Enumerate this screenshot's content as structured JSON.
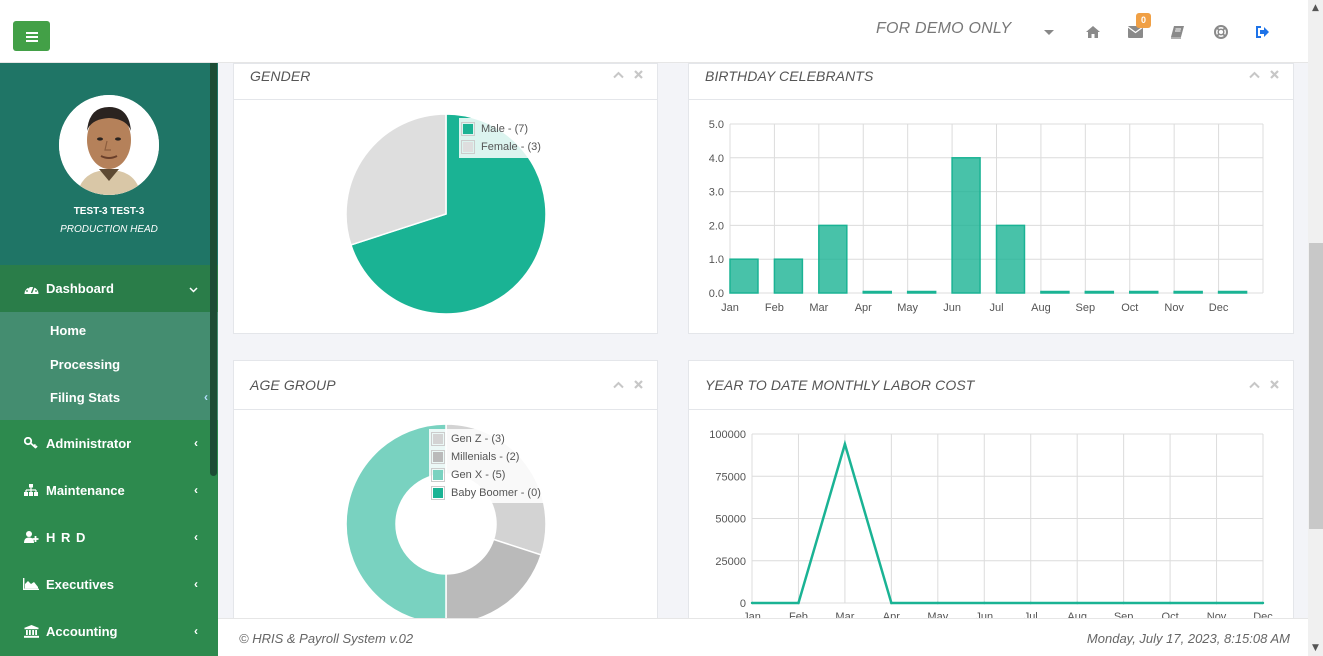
{
  "header": {
    "menu_toggle_icon": "bars-icon",
    "demo_label": "FOR DEMO ONLY",
    "icons": [
      "home-icon",
      "envelope-icon",
      "book-icon",
      "life-ring-icon",
      "sign-out-icon"
    ],
    "mail_badge": "0"
  },
  "profile": {
    "name": "TEST-3 TEST-3",
    "role": "PRODUCTION HEAD"
  },
  "sidebar": {
    "items": [
      {
        "label": "Dashboard",
        "icon": "tachometer-icon",
        "expanded": true
      },
      {
        "label": "Administrator",
        "icon": "key-icon"
      },
      {
        "label": "Maintenance",
        "icon": "sitemap-icon"
      },
      {
        "label": "H R D",
        "icon": "user-plus-icon"
      },
      {
        "label": "Executives",
        "icon": "area-chart-icon"
      },
      {
        "label": "Accounting",
        "icon": "bank-icon"
      }
    ],
    "dashboard_sub": [
      {
        "label": "Home"
      },
      {
        "label": "Processing"
      },
      {
        "label": "Filing Stats"
      }
    ]
  },
  "panels": {
    "gender": {
      "title": "GENDER"
    },
    "birthday": {
      "title": "BIRTHDAY CELEBRANTS"
    },
    "age": {
      "title": "AGE GROUP"
    },
    "labor": {
      "title": "YEAR TO DATE MONTHLY LABOR COST"
    }
  },
  "chart_data": [
    {
      "id": "gender",
      "type": "pie",
      "title": "GENDER",
      "legend_position": "top-right",
      "slices": [
        {
          "label": "Male - (7)",
          "name": "Male",
          "value": 7,
          "color": "#1ab394"
        },
        {
          "label": "Female - (3)",
          "name": "Female",
          "value": 3,
          "color": "#dedede"
        }
      ]
    },
    {
      "id": "birthday",
      "type": "bar",
      "title": "BIRTHDAY CELEBRANTS",
      "categories": [
        "Jan",
        "Feb",
        "Mar",
        "Apr",
        "May",
        "Jun",
        "Jul",
        "Aug",
        "Sep",
        "Oct",
        "Nov",
        "Dec"
      ],
      "values": [
        1,
        1,
        2,
        0,
        0,
        4,
        2,
        0,
        0,
        0,
        0,
        0
      ],
      "yticks": [
        "0.0",
        "1.0",
        "2.0",
        "3.0",
        "4.0",
        "5.0"
      ],
      "ylim": [
        0,
        5
      ],
      "grid": true,
      "color": "#1ab394"
    },
    {
      "id": "age",
      "type": "pie",
      "donut": true,
      "title": "AGE GROUP",
      "legend_position": "top-right",
      "slices": [
        {
          "label": "Gen Z - (3)",
          "name": "Gen Z",
          "value": 3,
          "color": "#d3d3d3"
        },
        {
          "label": "Millenials - (2)",
          "name": "Millenials",
          "value": 2,
          "color": "#bababa"
        },
        {
          "label": "Gen X - (5)",
          "name": "Gen X",
          "value": 5,
          "color": "#79d2c0"
        },
        {
          "label": "Baby Boomer - (0)",
          "name": "Baby Boomer",
          "value": 0,
          "color": "#1ab394"
        }
      ]
    },
    {
      "id": "labor",
      "type": "line",
      "title": "YEAR TO DATE MONTHLY LABOR COST",
      "categories": [
        "Jan",
        "Feb",
        "Mar",
        "Apr",
        "May",
        "Jun",
        "Jul",
        "Aug",
        "Sep",
        "Oct",
        "Nov",
        "Dec"
      ],
      "values": [
        0,
        0,
        94000,
        0,
        0,
        0,
        0,
        0,
        0,
        0,
        0,
        0
      ],
      "yticks": [
        "0",
        "25000",
        "50000",
        "75000",
        "100000"
      ],
      "ylim": [
        0,
        100000
      ],
      "grid": true,
      "color": "#1ab394"
    }
  ],
  "footer": {
    "copyright": "© HRIS & Payroll System v.02",
    "datetime": "Monday, July 17, 2023, 8:15:08 AM"
  }
}
